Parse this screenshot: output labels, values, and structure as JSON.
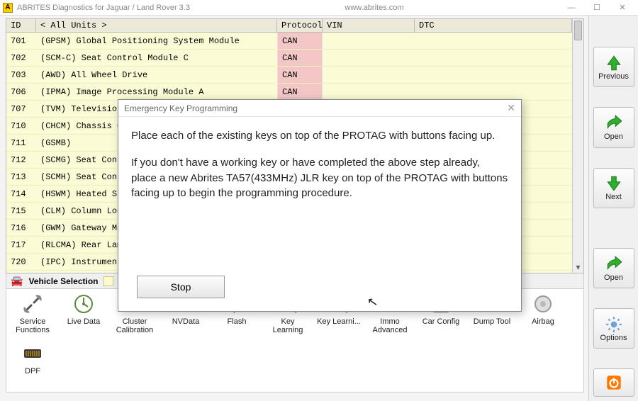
{
  "window": {
    "title": "ABRITES Diagnostics for Jaguar / Land Rover 3.3",
    "url": "www.abrites.com"
  },
  "table": {
    "headers": {
      "id": "ID",
      "unit": "< All Units >",
      "protocol": "Protocol",
      "vin": "VIN",
      "dtc": "DTC"
    },
    "rows": [
      {
        "id": "701",
        "unit": "(GPSM) Global Positioning System Module",
        "protocol": "CAN"
      },
      {
        "id": "702",
        "unit": "(SCM-C) Seat Control Module C",
        "protocol": "CAN"
      },
      {
        "id": "703",
        "unit": "(AWD) All Wheel Drive",
        "protocol": "CAN"
      },
      {
        "id": "706",
        "unit": "(IPMA) Image Processing Module A",
        "protocol": "CAN"
      },
      {
        "id": "707",
        "unit": "(TVM) Television",
        "protocol": ""
      },
      {
        "id": "710",
        "unit": "(CHCM) Chassis Co",
        "protocol": ""
      },
      {
        "id": "711",
        "unit": "(GSMB)",
        "protocol": ""
      },
      {
        "id": "712",
        "unit": "(SCMG) Seat Contr",
        "protocol": ""
      },
      {
        "id": "713",
        "unit": "(SCMH) Seat Contr",
        "protocol": ""
      },
      {
        "id": "714",
        "unit": "(HSWM) Heated Ste",
        "protocol": ""
      },
      {
        "id": "715",
        "unit": "(CLM) Column Lock",
        "protocol": ""
      },
      {
        "id": "716",
        "unit": "(GWM) Gateway Mod",
        "protocol": ""
      },
      {
        "id": "717",
        "unit": "(RLCMA) Rear Lamp",
        "protocol": ""
      },
      {
        "id": "720",
        "unit": "(IPC) Instrument",
        "protocol": ""
      }
    ]
  },
  "midbar": {
    "label": "Vehicle Selection"
  },
  "nav": {
    "previous": "Previous",
    "open1": "Open",
    "next": "Next",
    "open2": "Open",
    "options": "Options"
  },
  "tools": [
    {
      "name": "service-functions",
      "label": "Service Functions"
    },
    {
      "name": "live-data",
      "label": "Live Data"
    },
    {
      "name": "cluster-calibration",
      "label": "Cluster Calibration"
    },
    {
      "name": "nvdata",
      "label": "NVData"
    },
    {
      "name": "flash",
      "label": "Flash"
    },
    {
      "name": "key-learning",
      "label": "Key Learning"
    },
    {
      "name": "key-learning-dots",
      "label": "Key Learni..."
    },
    {
      "name": "immo-advanced",
      "label": "Immo Advanced"
    },
    {
      "name": "car-config",
      "label": "Car Config"
    },
    {
      "name": "dump-tool",
      "label": "Dump Tool"
    },
    {
      "name": "airbag",
      "label": "Airbag"
    },
    {
      "name": "dpf",
      "label": "DPF"
    }
  ],
  "modal": {
    "title": "Emergency Key Programming",
    "p1": "Place each of the existing keys on top of the PROTAG with buttons facing up.",
    "p2": "If you don't have a working key or have completed the above step already, place a new Abrites TA57(433MHz) JLR key on top of the PROTAG with buttons facing up to begin the programming procedure.",
    "stop": "Stop"
  }
}
